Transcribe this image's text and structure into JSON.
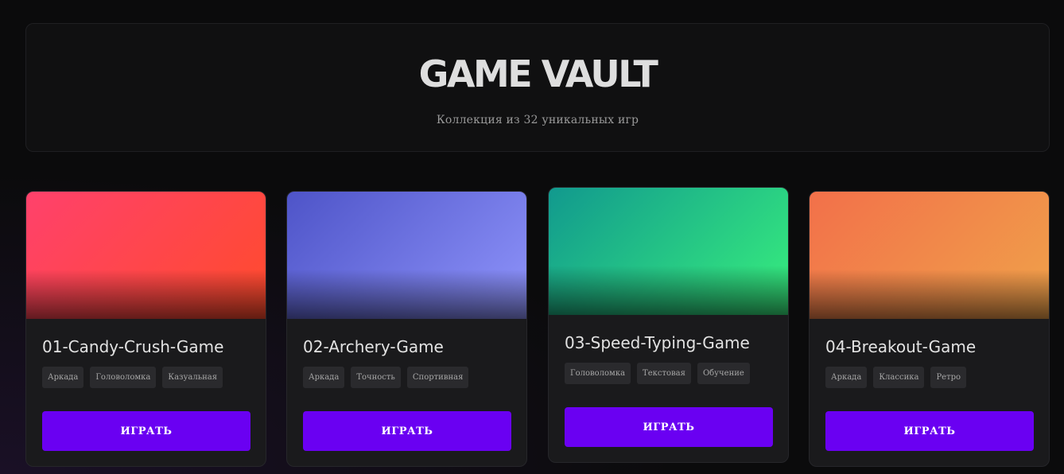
{
  "header": {
    "title": "GAME VAULT",
    "subtitle": "Коллекция из 32 уникальных игр"
  },
  "colors": {
    "accent": "#6a00f2",
    "background": "#0b0b0c",
    "card": "#1a1a1c"
  },
  "games": [
    {
      "title": "01-Candy-Crush-Game",
      "tags": [
        "Аркада",
        "Головоломка",
        "Казуальная"
      ],
      "play_label": "ИГРАТЬ",
      "gradient": [
        "#ff416c",
        "#ff4b2b"
      ]
    },
    {
      "title": "02-Archery-Game",
      "tags": [
        "Аркада",
        "Точность",
        "Спортивная"
      ],
      "play_label": "ИГРАТЬ",
      "gradient": [
        "#4e54c8",
        "#8f94fb"
      ]
    },
    {
      "title": "03-Speed-Typing-Game",
      "tags": [
        "Головоломка",
        "Текстовая",
        "Обучение"
      ],
      "play_label": "ИГРАТЬ",
      "gradient": [
        "#11998e",
        "#38ef7d"
      ]
    },
    {
      "title": "04-Breakout-Game",
      "tags": [
        "Аркада",
        "Классика",
        "Ретро"
      ],
      "play_label": "ИГРАТЬ",
      "gradient": [
        "#f2704a",
        "#f0a24a"
      ]
    }
  ]
}
